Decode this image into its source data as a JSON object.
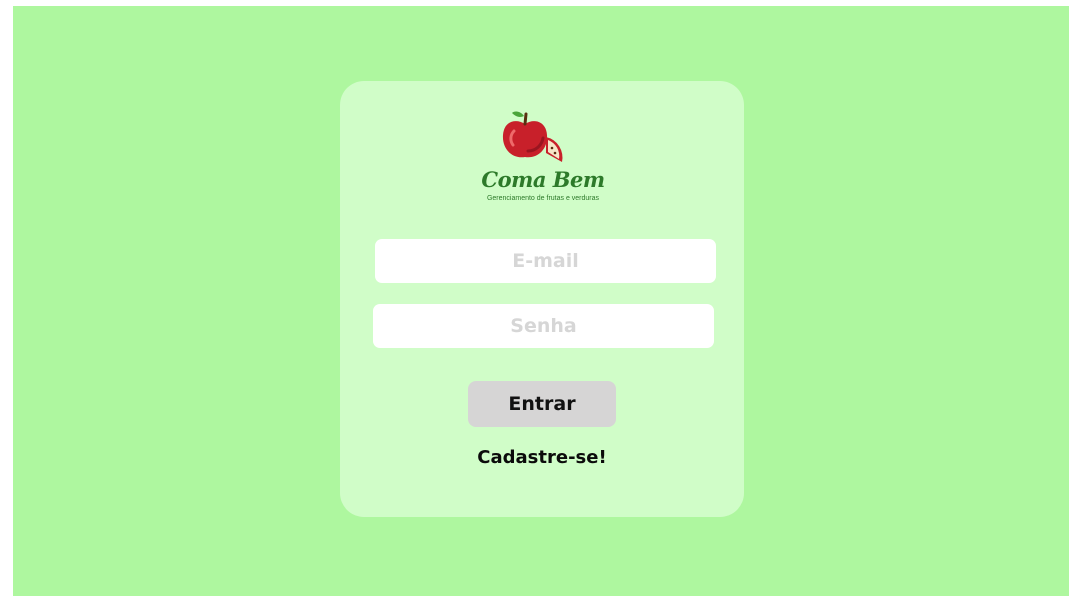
{
  "brand": {
    "name": "Coma Bem",
    "tagline": "Gerenciamento de frutas e verduras",
    "logo_icon": "apple-icon"
  },
  "login_form": {
    "email_placeholder": "E-mail",
    "email_value": "",
    "password_placeholder": "Senha",
    "password_value": "",
    "submit_label": "Entrar",
    "signup_label": "Cadastre-se!"
  },
  "colors": {
    "page_background": "#aef79f",
    "card_background": "#d0fdc8",
    "brand_green": "#2d7a2a",
    "apple_red": "#c8202a",
    "button_gray": "#d6d5d5"
  }
}
